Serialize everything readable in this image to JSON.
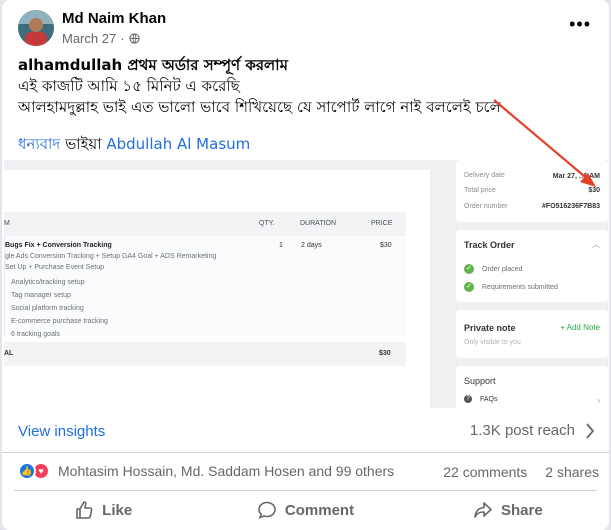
{
  "post": {
    "author": "Md Naim Khan",
    "date": "March 27",
    "lines": [
      "alhamdullah প্রথম অর্ডার সম্পূর্ণ করলাম",
      "এই কাজটি আমি ১৫ মিনিট এ করেছি",
      "আলহামদুল্লাহ ভাই এত ভালো ভাবে শিখিয়েছে যে সাপোর্ট লাগে নাই বললেই চলে"
    ],
    "thanks_prefix": "ধন্যবাদ",
    "thanks_mid": "ভাইয়া",
    "mention": "Abdullah Al Masum"
  },
  "order": {
    "table": {
      "headers": {
        "item": "M",
        "qty": "QTY.",
        "duration": "DURATION",
        "price": "PRICE"
      },
      "package_title": "Bugs Fix + Conversion Tracking",
      "package_sub1": "gle Ads Conversion Tracking + Setup GA4 Goal + ADS Remarketing",
      "package_sub2": "Set Up + Purchase Event Setup",
      "features": [
        "Analytics/tracking setup",
        "Tag manager setup",
        "Social platform tracking",
        "E-commerce purchase tracking",
        "6 tracking goals"
      ],
      "qty": "1",
      "duration": "2 days",
      "price": "$30",
      "total_label": "AL",
      "total_value": "$30"
    },
    "details": {
      "delivery_label": "Delivery date",
      "delivery_value": "Mar 27, ‥6 AM",
      "total_label": "Total price",
      "total_value": "$30",
      "number_label": "Order number",
      "number_value": "#FO516236F7B83"
    },
    "track": {
      "title": "Track Order",
      "steps": [
        "Order placed",
        "Requirements submitted"
      ]
    },
    "note": {
      "title": "Private note",
      "add": "+ Add Note",
      "hint": "Only visible to you"
    },
    "support": {
      "title": "Support",
      "faqs": "FAQs"
    }
  },
  "footer": {
    "insights": "View insights",
    "reach": "1.3K post reach",
    "reactors": "Mohtasim Hossain, Md. Saddam Hosen and 99 others",
    "comments": "22 comments",
    "shares": "2 shares",
    "like": "Like",
    "comment": "Comment",
    "share": "Share"
  },
  "colors": {
    "link": "#216fdb",
    "like_blue": "#1b74e4",
    "love_red": "#f33e58",
    "step_green": "#62b34b",
    "arrow_red": "#e5402a"
  },
  "icons": {
    "globe": "globe-icon",
    "more": "more-options-icon",
    "like": "thumbs-up-icon",
    "love": "heart-icon",
    "comment": "comment-bubble-icon",
    "share": "share-arrow-icon"
  }
}
